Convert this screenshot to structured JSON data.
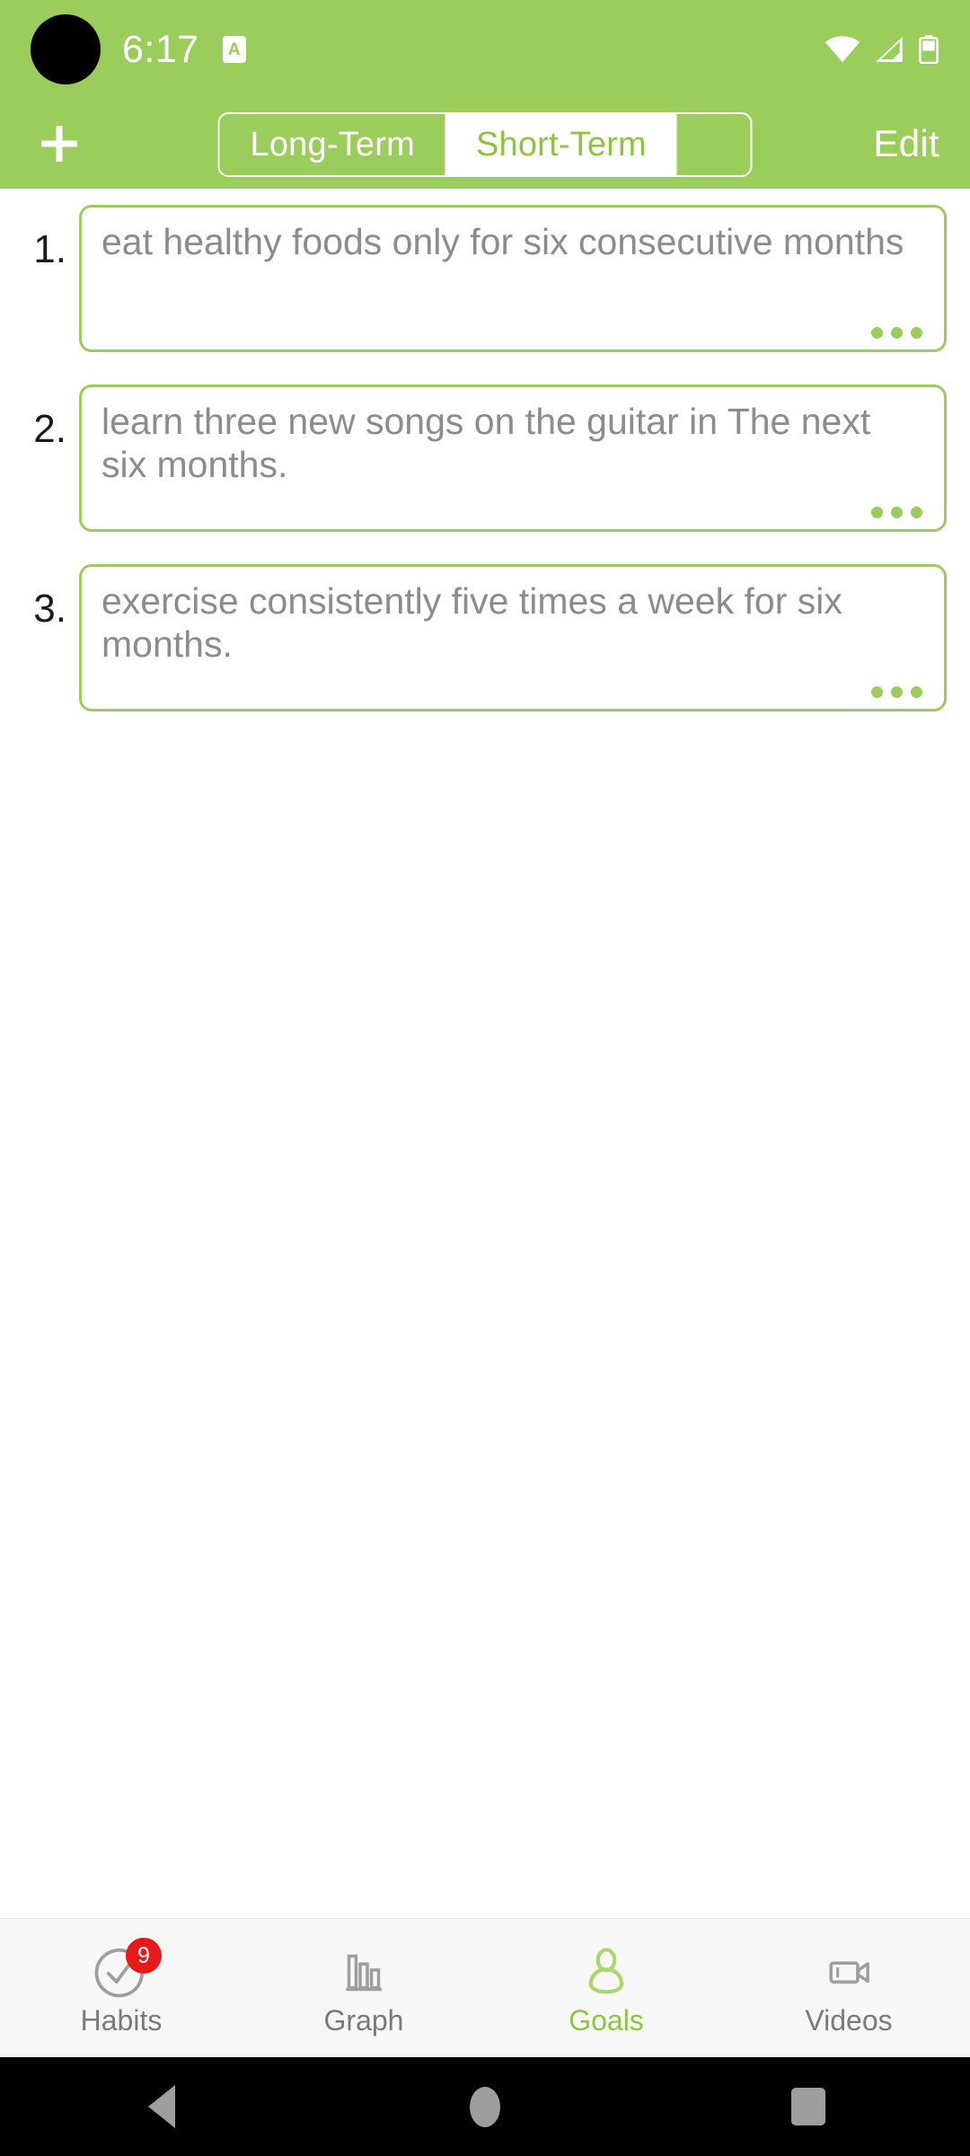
{
  "status_bar": {
    "time": "6:17",
    "app_icon_letter": "A",
    "icons": [
      "wifi-icon",
      "cellular-signal-icon",
      "battery-icon"
    ],
    "background_color": "#9ACD5B"
  },
  "header": {
    "add_label": "+",
    "edit_label": "Edit",
    "segmented_control": {
      "selected": "Long-Term",
      "options": [
        {
          "label": "Long-Term",
          "selected": true
        },
        {
          "label": "Short-Term",
          "selected": false
        }
      ]
    }
  },
  "goals": {
    "items": [
      {
        "number": "1.",
        "text": "eat healthy foods only for six consecutive months",
        "menu": "•••"
      },
      {
        "number": "2.",
        "text": "learn three new songs on the guitar in The next six months.",
        "menu": "•••"
      },
      {
        "number": "3.",
        "text": "exercise consistently five times a week for six months.",
        "menu": "•••"
      }
    ]
  },
  "bottom_nav": {
    "items": [
      {
        "label": "Habits",
        "icon": "check-circle-icon",
        "active": false,
        "badge": "9"
      },
      {
        "label": "Graph",
        "icon": "bar-chart-icon",
        "active": false,
        "badge": ""
      },
      {
        "label": "Goals",
        "icon": "person-icon",
        "active": true,
        "badge": ""
      },
      {
        "label": "Videos",
        "icon": "video-camera-icon",
        "active": false,
        "badge": ""
      }
    ],
    "active_color": "#8CC63E",
    "inactive_color": "#7a7a7a",
    "badge_color": "#E8191B"
  },
  "android_nav": {
    "back": "back-triangle",
    "home": "home-circle",
    "recents": "recents-square"
  },
  "theme": {
    "accent": "#9ACD5B",
    "accent_text": "#8CC63E",
    "card_text": "#8c8c8c",
    "page_background": "#FFFFFF"
  }
}
